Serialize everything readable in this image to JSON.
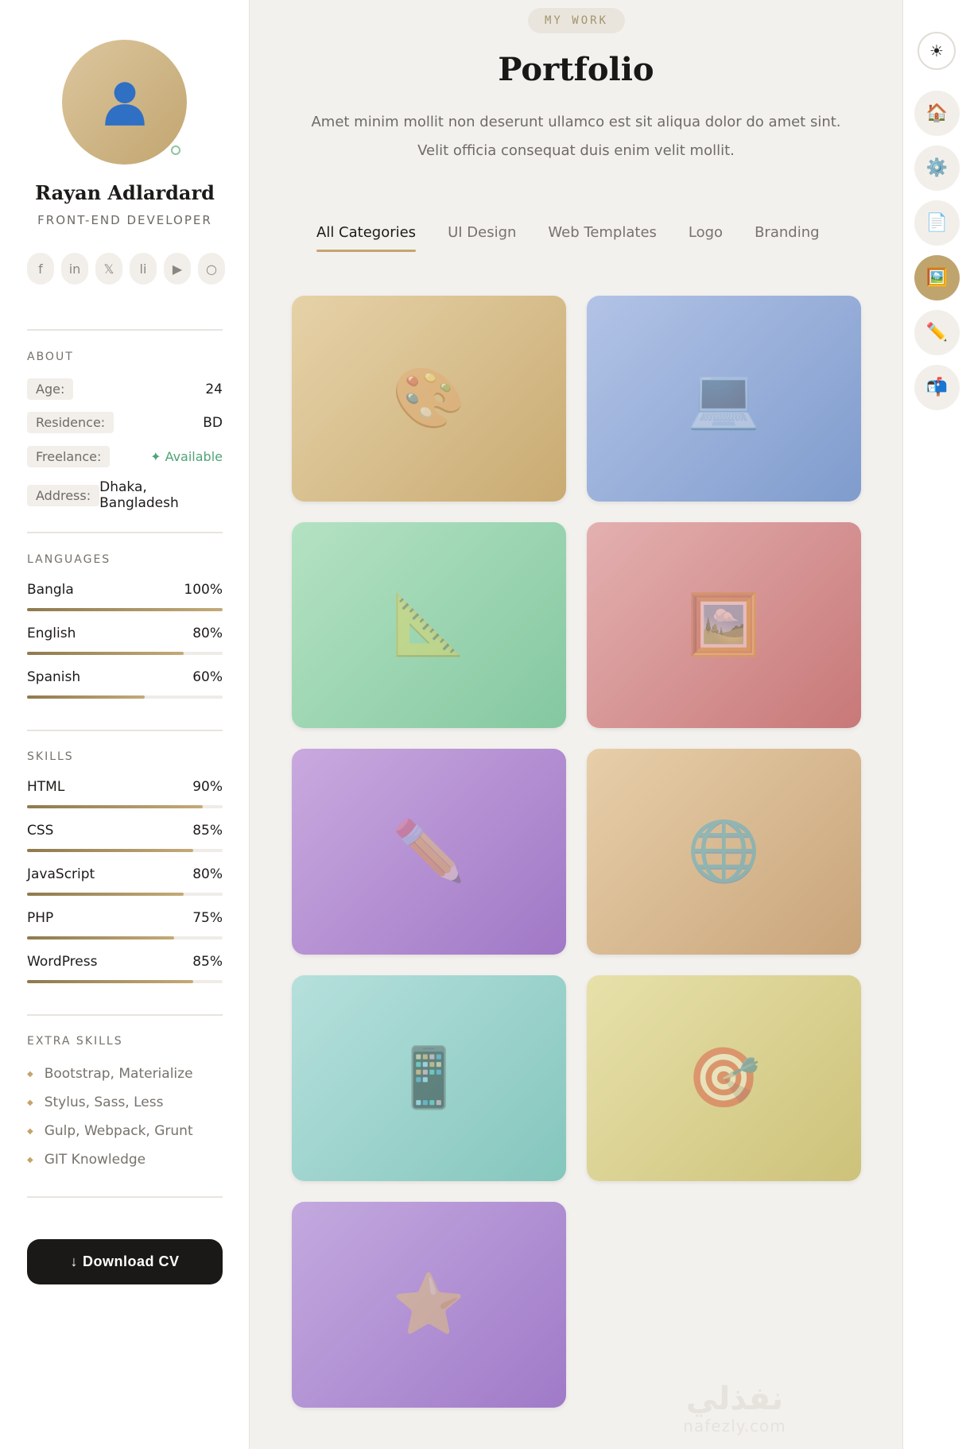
{
  "profile": {
    "name": "Rayan Adlardard",
    "role": "FRONT-END DEVELOPER",
    "socials": [
      {
        "icon": "facebook-icon",
        "glyph": "f"
      },
      {
        "icon": "linkedin-icon",
        "glyph": "in"
      },
      {
        "icon": "x-icon",
        "glyph": "𝕏"
      },
      {
        "icon": "li-icon",
        "glyph": "li"
      },
      {
        "icon": "youtube-icon",
        "glyph": "▶"
      },
      {
        "icon": "circle-icon",
        "glyph": "○"
      }
    ]
  },
  "about": {
    "title": "ABOUT",
    "rows": [
      {
        "label": "Age:",
        "value": "24"
      },
      {
        "label": "Residence:",
        "value": "BD"
      },
      {
        "label": "Freelance:",
        "value": "✦ Available"
      },
      {
        "label": "Address:",
        "value": "Dhaka, Bangladesh"
      }
    ]
  },
  "languages": {
    "title": "LANGUAGES",
    "items": [
      {
        "name": "Bangla",
        "label": "100%",
        "pct": 100
      },
      {
        "name": "English",
        "label": "80%",
        "pct": 80
      },
      {
        "name": "Spanish",
        "label": "60%",
        "pct": 60
      }
    ]
  },
  "skills": {
    "title": "SKILLS",
    "items": [
      {
        "name": "HTML",
        "label": "90%",
        "pct": 90
      },
      {
        "name": "CSS",
        "label": "85%",
        "pct": 85
      },
      {
        "name": "JavaScript",
        "label": "80%",
        "pct": 80
      },
      {
        "name": "PHP",
        "label": "75%",
        "pct": 75
      },
      {
        "name": "WordPress",
        "label": "85%",
        "pct": 85
      }
    ]
  },
  "extra_skills": {
    "title": "EXTRA SKILLS",
    "items": [
      "Bootstrap, Materialize",
      "Stylus, Sass, Less",
      "Gulp, Webpack, Grunt",
      "GIT Knowledge"
    ]
  },
  "download": {
    "icon": "↓",
    "label": "Download CV"
  },
  "portfolio": {
    "eyebrow": "MY WORK",
    "title": "Portfolio",
    "lead_line1": "Amet minim mollit non deserunt ullamco est sit aliqua dolor do amet sint.",
    "lead_line2": "Velit officia consequat duis enim velit mollit.",
    "tabs": [
      "All Categories",
      "UI Design",
      "Web Templates",
      "Logo",
      "Branding"
    ],
    "active_tab": 0,
    "cards": [
      {
        "icon": "palette-icon",
        "glyph": "🎨",
        "colors": [
          "#e6d2a8",
          "#c9ab72"
        ]
      },
      {
        "icon": "laptop-icon",
        "glyph": "💻",
        "colors": [
          "#b2c3e6",
          "#7f9ccd"
        ]
      },
      {
        "icon": "triangle-ruler-icon",
        "glyph": "📐",
        "colors": [
          "#b4e2c3",
          "#84c8a0"
        ]
      },
      {
        "icon": "framed-picture-icon",
        "glyph": "🖼️",
        "colors": [
          "#e4b0b0",
          "#c87878"
        ]
      },
      {
        "icon": "pencil-icon",
        "glyph": "✏️",
        "colors": [
          "#c9a9df",
          "#a078c6"
        ]
      },
      {
        "icon": "globe-icon",
        "glyph": "🌐",
        "colors": [
          "#e7cfa9",
          "#c9a47a"
        ]
      },
      {
        "icon": "mobile-phone-icon",
        "glyph": "📱",
        "colors": [
          "#b6e0dc",
          "#84c6bd"
        ]
      },
      {
        "icon": "target-icon",
        "glyph": "🎯",
        "colors": [
          "#e7e1aa",
          "#cdc27a"
        ]
      },
      {
        "icon": "star-icon",
        "glyph": "⭐",
        "colors": [
          "#c3a9df",
          "#a07ac8"
        ]
      }
    ]
  },
  "rail": [
    {
      "icon": "sun-icon",
      "glyph": "☀"
    },
    {
      "icon": "home-icon",
      "glyph": "🏠"
    },
    {
      "icon": "gear-icon",
      "glyph": "⚙️"
    },
    {
      "icon": "document-icon",
      "glyph": "📄"
    },
    {
      "icon": "picture-icon",
      "glyph": "🖼️"
    },
    {
      "icon": "pencil-icon",
      "glyph": "✏️"
    },
    {
      "icon": "mailbox-icon",
      "glyph": "📬"
    }
  ],
  "rail_active": 4,
  "watermark": {
    "ar": "نفذلي",
    "en": "nafezly.com"
  }
}
